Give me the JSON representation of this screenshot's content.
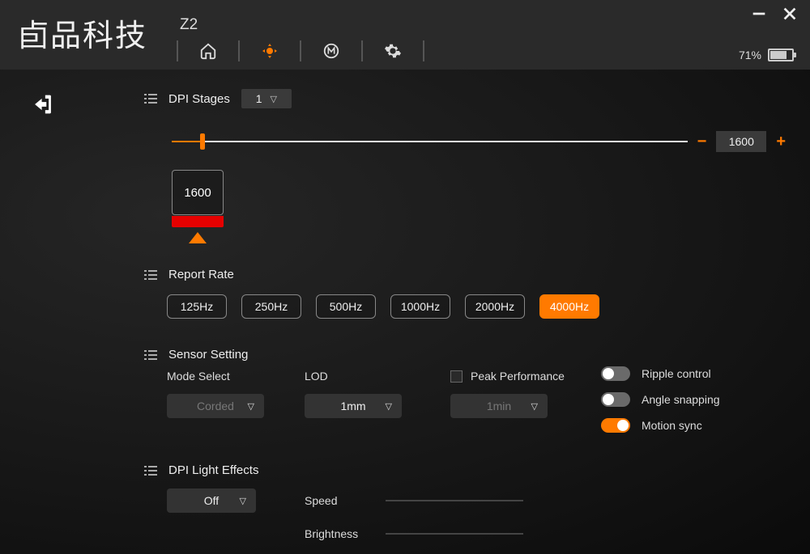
{
  "app": {
    "logo_text": "卣品科技",
    "title": "Z2",
    "battery_pct": "71%"
  },
  "dpi": {
    "section_label": "DPI Stages",
    "stage_selected": "1",
    "value": "1600",
    "tile_value": "1600",
    "slider_pct": 6
  },
  "report_rate": {
    "label": "Report Rate",
    "options": [
      "125Hz",
      "250Hz",
      "500Hz",
      "1000Hz",
      "2000Hz",
      "4000Hz"
    ],
    "selected": "4000Hz"
  },
  "sensor": {
    "section_label": "Sensor Setting",
    "mode_label": "Mode Select",
    "mode_value": "Corded",
    "lod_label": "LOD",
    "lod_value": "1mm",
    "peak_label": "Peak Performance",
    "peak_value": "1min",
    "toggles": {
      "ripple": {
        "label": "Ripple control",
        "on": false
      },
      "angle": {
        "label": "Angle snapping",
        "on": false
      },
      "motion": {
        "label": "Motion sync",
        "on": true
      }
    }
  },
  "light": {
    "section_label": "DPI Light Effects",
    "mode_value": "Off",
    "speed_label": "Speed",
    "brightness_label": "Brightness"
  }
}
